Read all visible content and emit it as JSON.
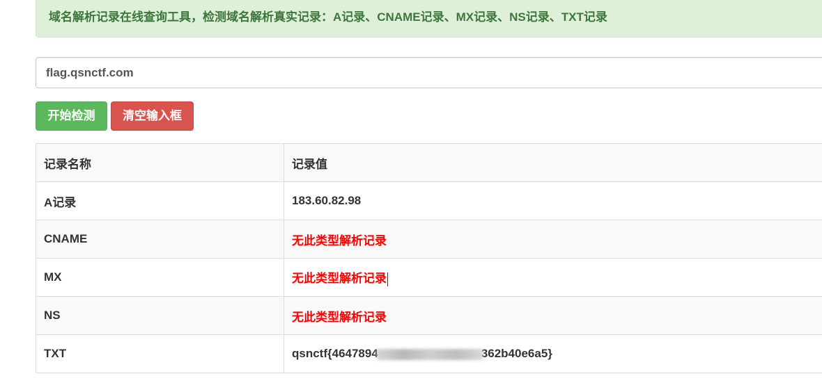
{
  "alert": {
    "text": "域名解析记录在线查询工具，检测域名解析真实记录：A记录、CNAME记录、MX记录、NS记录、TXT记录"
  },
  "domain_input": {
    "value": "flag.qsnctf.com"
  },
  "buttons": {
    "start_label": "开始检测",
    "clear_label": "清空输入框"
  },
  "table": {
    "headers": [
      "记录名称",
      "记录值"
    ],
    "rows": [
      {
        "name": "A记录",
        "value": "183.60.82.98"
      },
      {
        "name": "CNAME",
        "value": "无此类型解析记录"
      },
      {
        "name": "MX",
        "value": "无此类型解析记录"
      },
      {
        "name": "NS",
        "value": "无此类型解析记录"
      },
      {
        "name": "TXT",
        "value_prefix": "qsnctf{4647894",
        "value_suffix": "362b40e6a5}"
      }
    ]
  },
  "colors": {
    "alert_bg": "#dff0d8",
    "alert_text": "#3c763d",
    "start_button": "#5cb85c",
    "clear_button": "#d9534f",
    "no_record_text": "#ff0000"
  }
}
